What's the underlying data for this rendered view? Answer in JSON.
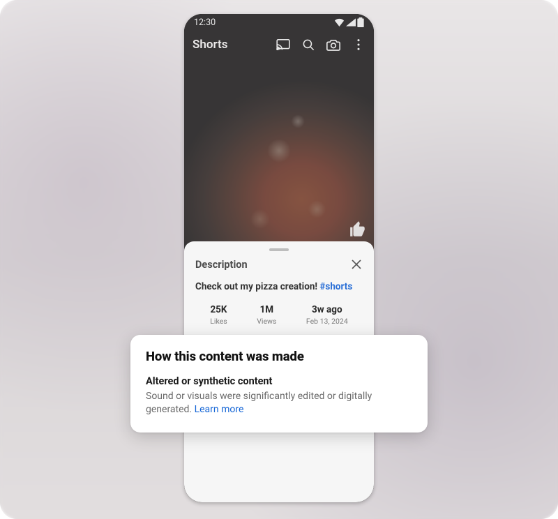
{
  "status": {
    "time": "12:30"
  },
  "header": {
    "title": "Shorts",
    "icons": {
      "cast": "cast-icon",
      "search": "search-icon",
      "camera": "camera-icon",
      "more": "more-vertical-icon"
    }
  },
  "sheet": {
    "title": "Description",
    "caption_text": "Check out my pizza creation! ",
    "caption_hashtag": "#shorts",
    "stats": [
      {
        "value": "25K",
        "label": "Likes"
      },
      {
        "value": "1M",
        "label": "Views"
      },
      {
        "value": "3w ago",
        "label": "Feb 13, 2024"
      }
    ]
  },
  "disclosure": {
    "heading": "How this content was made",
    "subheading": "Altered or synthetic content",
    "body": "Sound or visuals were significantly edited or digitally generated. ",
    "learn_more": "Learn more"
  }
}
